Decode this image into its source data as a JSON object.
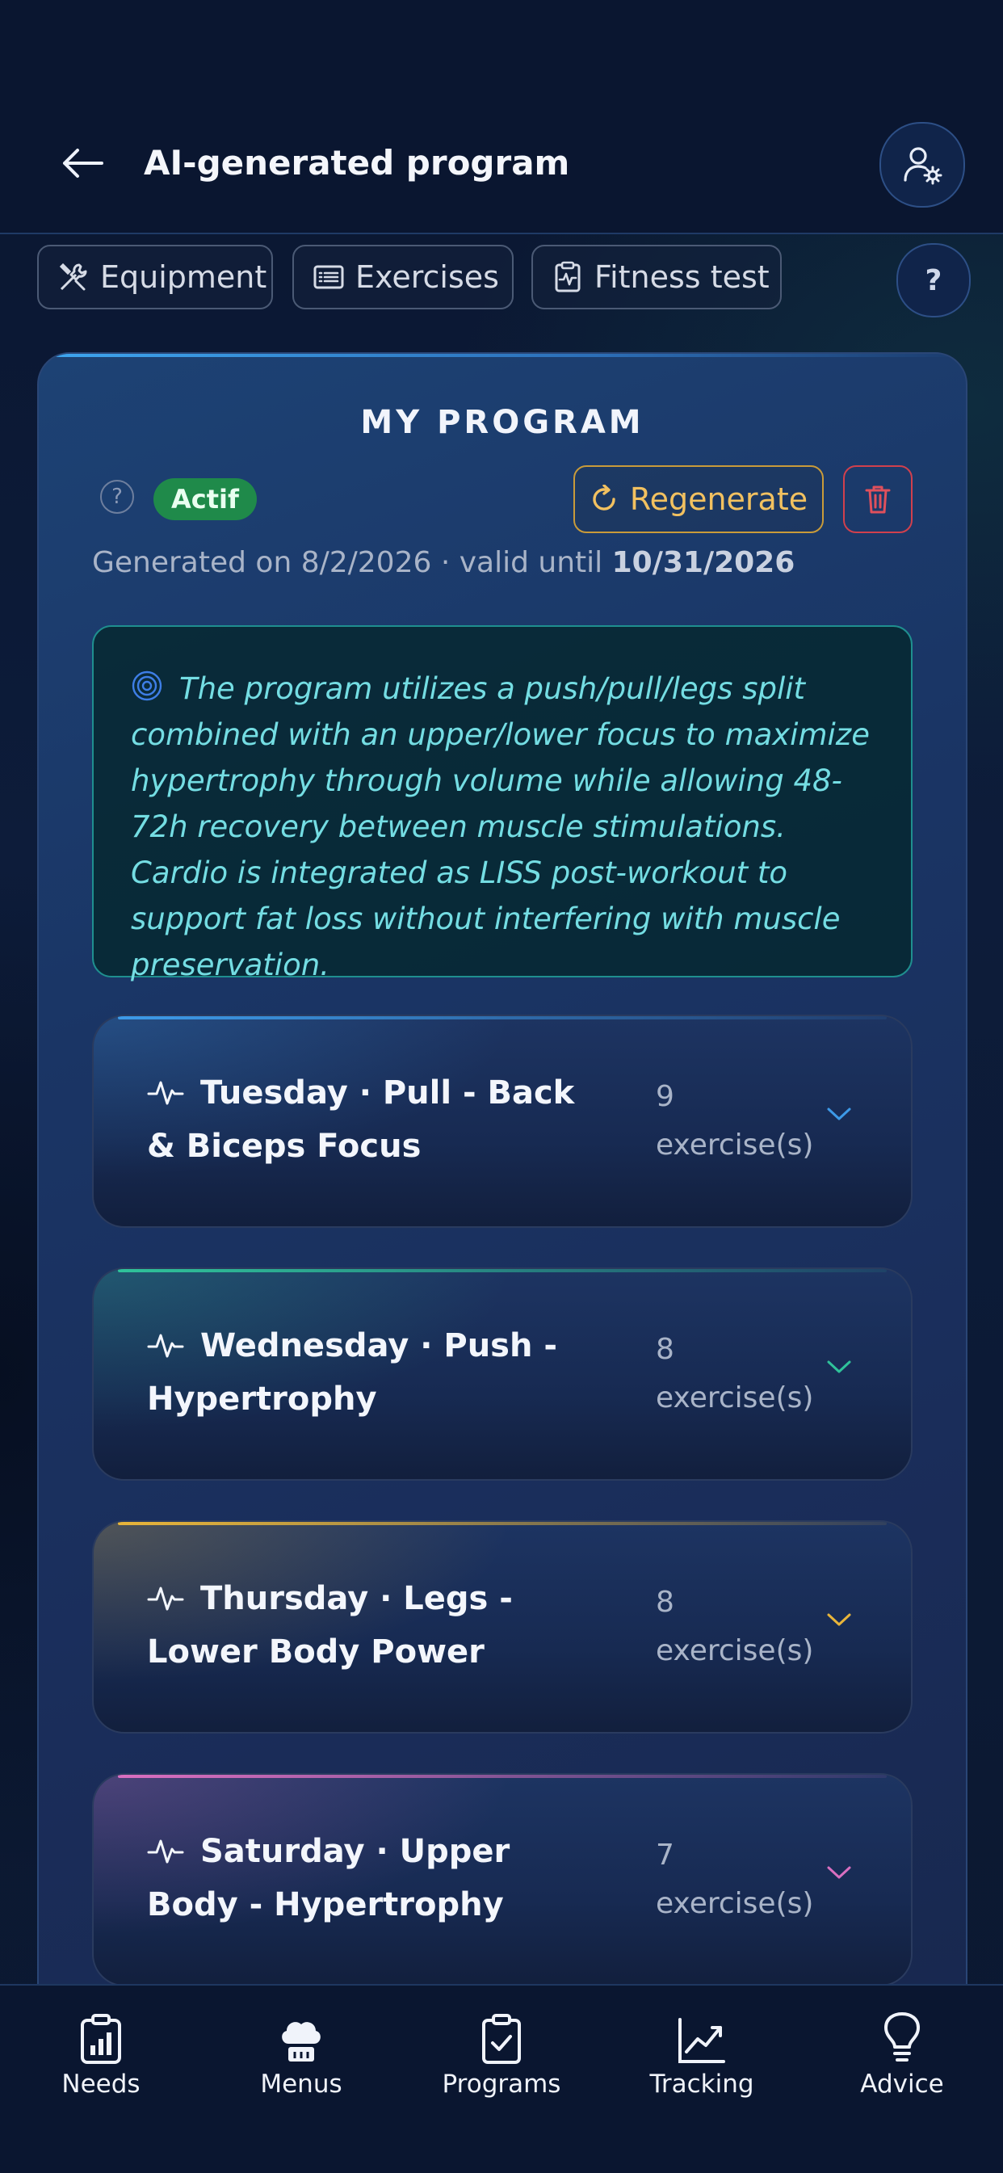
{
  "header": {
    "title": "AI-generated program"
  },
  "chips": [
    {
      "label": "Equipment",
      "icon": "tools-icon"
    },
    {
      "label": "Exercises",
      "icon": "list-icon"
    },
    {
      "label": "Fitness test",
      "icon": "clipboard-pulse-icon"
    }
  ],
  "help_label": "?",
  "program": {
    "heading": "MY PROGRAM",
    "status": "Actif",
    "regenerate_label": "Regenerate",
    "generated_prefix": "Generated on 8/2/2026 · valid until ",
    "valid_until": "10/31/2026",
    "summary": "The program utilizes a push/pull/legs split combined with an upper/lower focus to maximize hypertrophy through volume while allowing 48-72h recovery between muscle stimulations. Cardio is integrated as LISS post-workout to support fat loss without interfering with muscle preservation.",
    "days": [
      {
        "title": "Tuesday · Pull - Back & Biceps Focus",
        "count": "9 exercise(s)",
        "accent": "#3d9ae8"
      },
      {
        "title": "Wednesday · Push - Hypertrophy",
        "count": "8 exercise(s)",
        "accent": "#2fc29a"
      },
      {
        "title": "Thursday · Legs - Lower Body Power",
        "count": "8 exercise(s)",
        "accent": "#e8b53a"
      },
      {
        "title": "Saturday · Upper Body - Hypertrophy",
        "count": "7 exercise(s)",
        "accent": "#d96fc0"
      }
    ]
  },
  "nav": [
    {
      "label": "Needs",
      "icon": "bar-chart-clipboard-icon"
    },
    {
      "label": "Menus",
      "icon": "chef-hat-icon"
    },
    {
      "label": "Programs",
      "icon": "clipboard-check-icon"
    },
    {
      "label": "Tracking",
      "icon": "trend-chart-icon"
    },
    {
      "label": "Advice",
      "icon": "lightbulb-icon"
    }
  ]
}
